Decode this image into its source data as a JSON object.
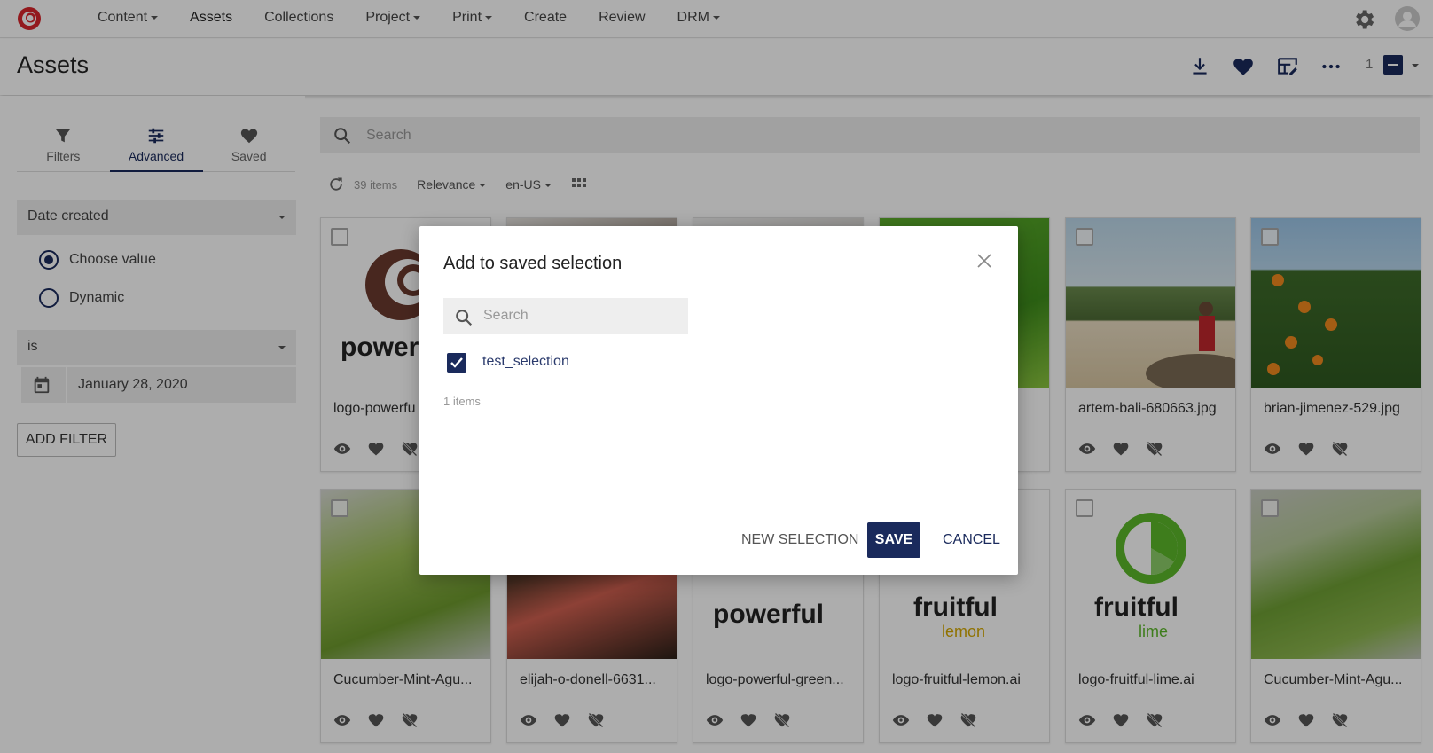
{
  "nav": {
    "items": [
      {
        "label": "Content",
        "dropdown": true
      },
      {
        "label": "Assets",
        "dropdown": false
      },
      {
        "label": "Collections",
        "dropdown": false
      },
      {
        "label": "Project",
        "dropdown": true
      },
      {
        "label": "Print",
        "dropdown": true
      },
      {
        "label": "Create",
        "dropdown": false
      },
      {
        "label": "Review",
        "dropdown": false
      },
      {
        "label": "DRM",
        "dropdown": true
      }
    ]
  },
  "header": {
    "title": "Assets",
    "selected_count": "1"
  },
  "sidebar": {
    "tabs": [
      {
        "label": "Filters",
        "icon": "filter-icon"
      },
      {
        "label": "Advanced",
        "icon": "sliders-icon"
      },
      {
        "label": "Saved",
        "icon": "heart-icon"
      }
    ],
    "field_select": "Date created",
    "radio_choose": "Choose value",
    "radio_dynamic": "Dynamic",
    "operator_select": "is",
    "date_value": "January 28, 2020",
    "add_filter": "ADD FILTER"
  },
  "main": {
    "search_placeholder": "Search",
    "item_count": "39 items",
    "sort": "Relevance",
    "locale": "en-US",
    "cards": [
      {
        "name": "logo-powerfu"
      },
      {
        "name": ""
      },
      {
        "name": ""
      },
      {
        "name": ""
      },
      {
        "name": "artem-bali-680663.jpg"
      },
      {
        "name": "brian-jimenez-529.jpg"
      },
      {
        "name": "Cucumber-Mint-Agu..."
      },
      {
        "name": "elijah-o-donell-6631..."
      },
      {
        "name": "logo-powerful-green..."
      },
      {
        "name": "logo-fruitful-lemon.ai"
      },
      {
        "name": "logo-fruitful-lime.ai"
      },
      {
        "name": "Cucumber-Mint-Agu..."
      }
    ],
    "logo_text": {
      "powerful": "powerful",
      "fruitful": "fruitful",
      "lemon": "lemon",
      "lime": "lime",
      "power": "power"
    }
  },
  "modal": {
    "title": "Add to saved selection",
    "search_placeholder": "Search",
    "selections": [
      {
        "label": "test_selection",
        "checked": true
      }
    ],
    "count": "1 items",
    "new_selection": "NEW SELECTION",
    "save": "SAVE",
    "cancel": "CANCEL"
  },
  "colors": {
    "accent": "#1a2a5c",
    "brand_red": "#d9262c"
  }
}
